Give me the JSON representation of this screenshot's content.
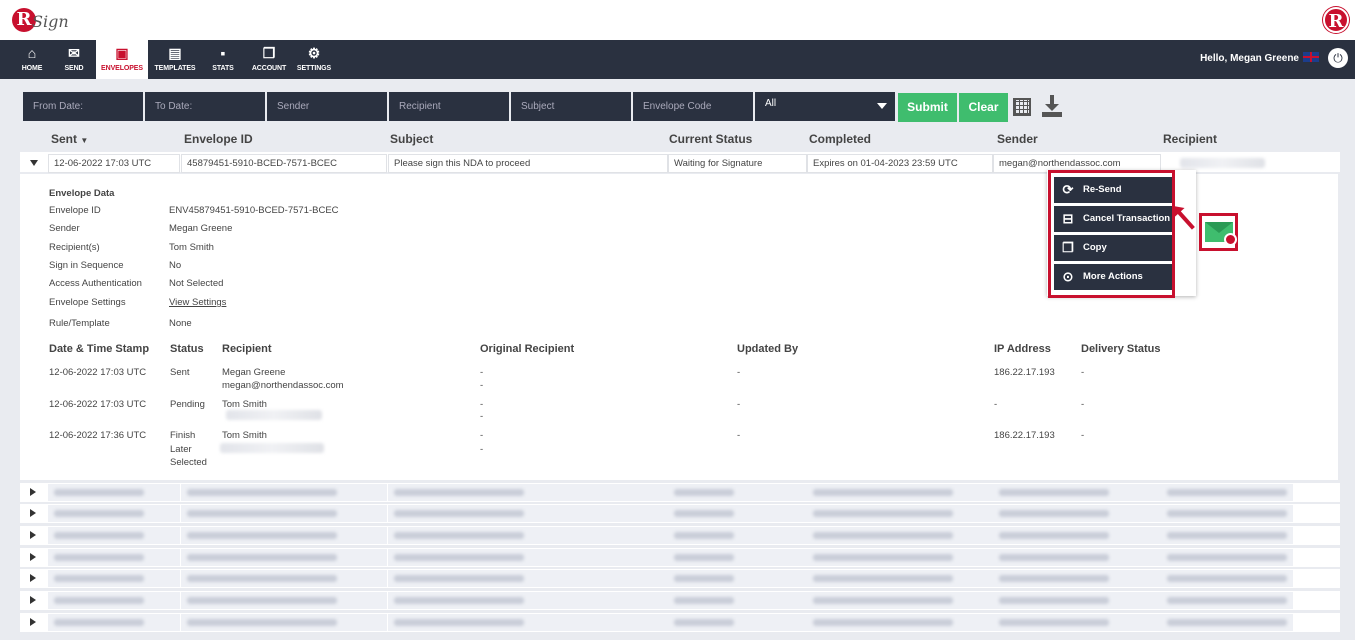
{
  "app": {
    "logo_text": "R",
    "logo_sub": "Sign"
  },
  "nav": {
    "items": [
      {
        "label": "HOME",
        "icon": "home-icon"
      },
      {
        "label": "SEND",
        "icon": "mail-icon"
      },
      {
        "label": "ENVELOPES",
        "icon": "envelope-box-icon"
      },
      {
        "label": "TEMPLATES",
        "icon": "templates-icon"
      },
      {
        "label": "STATS",
        "icon": "briefcase-icon"
      },
      {
        "label": "ACCOUNT",
        "icon": "account-icon"
      },
      {
        "label": "SETTINGS",
        "icon": "gear-icon"
      }
    ],
    "active": "ENVELOPES",
    "greeting": "Hello, Megan Greene"
  },
  "filters": {
    "from_date": "From Date:",
    "to_date": "To Date:",
    "sender": "Sender",
    "recipient": "Recipient",
    "subject": "Subject",
    "envelope_code": "Envelope Code",
    "status_select": "All",
    "submit": "Submit",
    "clear": "Clear"
  },
  "columns": [
    "Sent",
    "Envelope ID",
    "Subject",
    "Current Status",
    "Completed",
    "Sender",
    "Recipient"
  ],
  "row": {
    "sent": "12-06-2022 17:03 UTC",
    "envelope_id": "45879451-5910-BCED-7571-BCEC",
    "subject": "Please sign this NDA to proceed",
    "status": "Waiting for Signature",
    "completed": "Expires on 01-04-2023 23:59 UTC",
    "sender": "megan@northendassoc.com"
  },
  "envelope_data": {
    "heading": "Envelope Data",
    "fields": [
      {
        "label": "Envelope ID",
        "value": "ENV45879451-5910-BCED-7571-BCEC"
      },
      {
        "label": "Sender",
        "value": "Megan Greene"
      },
      {
        "label": "Recipient(s)",
        "value": "Tom Smith"
      },
      {
        "label": "Sign in Sequence",
        "value": "No"
      },
      {
        "label": "Access Authentication",
        "value": "Not Selected"
      },
      {
        "label": "Envelope Settings",
        "value": "View Settings"
      },
      {
        "label": "Rule/Template",
        "value": "None"
      }
    ]
  },
  "history": {
    "headers": [
      "Date & Time Stamp",
      "Status",
      "Recipient",
      "Original Recipient",
      "Updated By",
      "IP Address",
      "Delivery Status"
    ],
    "rows": [
      {
        "date": "12-06-2022 17:03 UTC",
        "status": "Sent",
        "recipient": "Megan Greene",
        "recipient2": "megan@northendassoc.com",
        "orig": "-",
        "orig2": "-",
        "updated": "-",
        "ip": "186.22.17.193",
        "delivery": "-"
      },
      {
        "date": "12-06-2022 17:03 UTC",
        "status": "Pending",
        "recipient": "Tom Smith",
        "recipient2": "",
        "orig": "-",
        "orig2": "-",
        "updated": "-",
        "ip": "-",
        "delivery": "-"
      },
      {
        "date": "12-06-2022 17:36 UTC",
        "status": "Finish Later Selected",
        "recipient": "Tom Smith",
        "recipient2": "",
        "orig": "-",
        "orig2": "-",
        "updated": "-",
        "ip": "186.22.17.193",
        "delivery": "-"
      }
    ]
  },
  "actions_menu": {
    "items": [
      {
        "label": "Re-Send",
        "icon": "refresh-icon"
      },
      {
        "label": "Cancel Transaction",
        "icon": "inbox-icon"
      },
      {
        "label": "Copy",
        "icon": "copy-icon"
      },
      {
        "label": "More Actions",
        "icon": "more-icon"
      }
    ]
  },
  "colors": {
    "brand_red": "#c8102e",
    "nav_dark": "#2a3140",
    "green": "#3fbd6e"
  }
}
